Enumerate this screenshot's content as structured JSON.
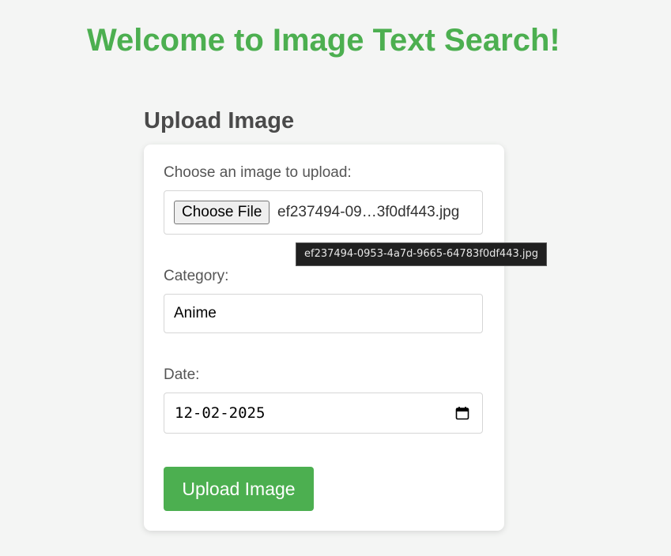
{
  "header": {
    "title": "Welcome to Image Text Search!"
  },
  "upload_section": {
    "title": "Upload Image",
    "file": {
      "label": "Choose an image to upload:",
      "button_label": "Choose File",
      "file_name_display": "ef237494-09…3f0df443.jpg",
      "tooltip": "ef237494-0953-4a7d-9665-64783f0df443.jpg"
    },
    "category": {
      "label": "Category:",
      "value": "Anime"
    },
    "date": {
      "label": "Date:",
      "value": "12-02-2025",
      "icon": "calendar-icon"
    },
    "submit_label": "Upload Image"
  },
  "colors": {
    "accent": "#4caf50",
    "background": "#f4f5f4",
    "card": "#ffffff",
    "heading_text": "#4a4a4a",
    "tooltip_bg": "#202020"
  }
}
